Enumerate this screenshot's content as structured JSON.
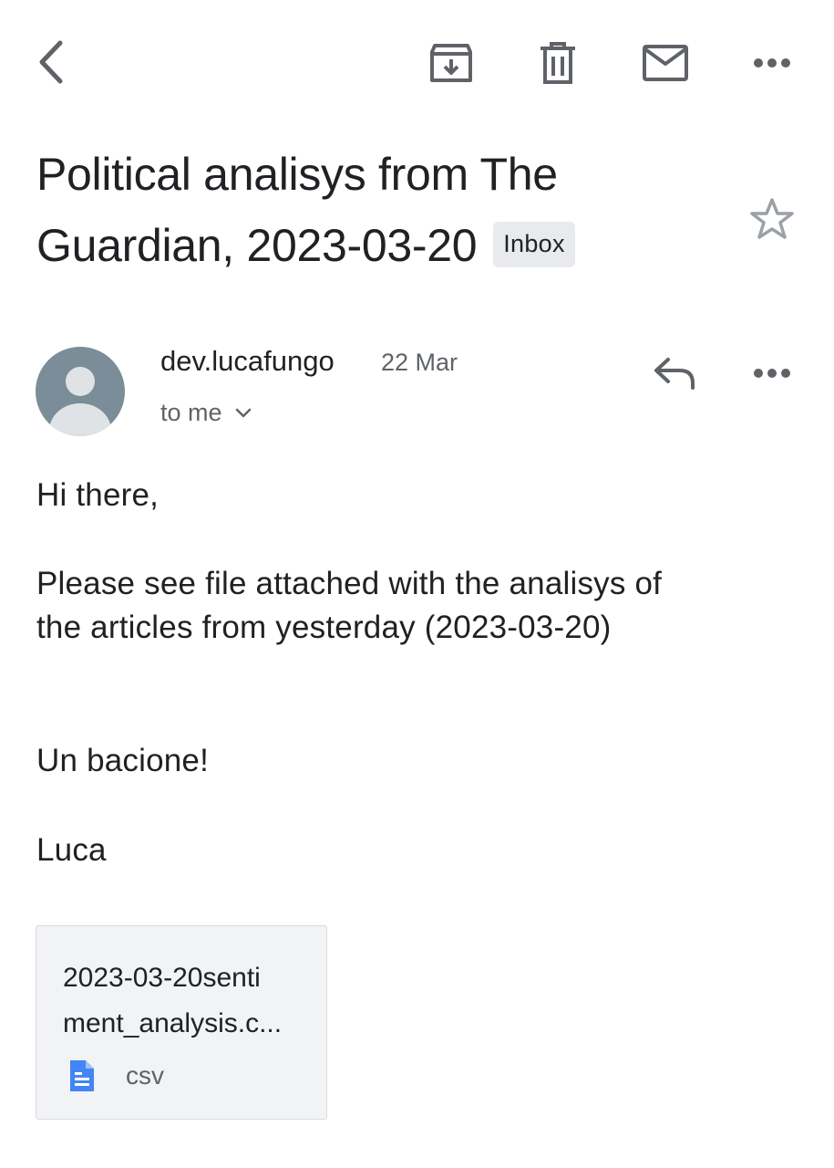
{
  "toolbar": {
    "back_icon": "chevron-left-icon",
    "archive_icon": "archive-icon",
    "delete_icon": "trash-icon",
    "mark_unread_icon": "mail-icon",
    "more_icon": "more-horizontal-icon"
  },
  "message": {
    "subject_line1": "Political analisys from The",
    "subject_line2": "Guardian, 2023-03-20",
    "label_badge": "Inbox",
    "star_icon": "star-outline-icon"
  },
  "sender": {
    "name": "dev.lucafungo",
    "date": "22 Mar",
    "recipients": "to me",
    "avatar_icon": "person-avatar-icon",
    "reply_icon": "reply-icon",
    "more_icon": "more-horizontal-icon"
  },
  "body": {
    "greeting": "Hi there,",
    "line1": "Please see file attached with the analisys of",
    "line2": "the articles from yesterday (2023-03-20)",
    "closing": "Un bacione!",
    "signature": "Luca"
  },
  "attachment": {
    "name_line1": "2023-03-20senti",
    "name_line2": "ment_analysis.c...",
    "type": "csv",
    "file_icon": "document-icon",
    "icon_color": "#4285f4"
  },
  "colors": {
    "text_primary": "#202124",
    "text_secondary": "#5f6368",
    "icon_gray": "#5f6368",
    "badge_bg": "#e8eaed",
    "avatar_bg": "#7a8d99"
  }
}
